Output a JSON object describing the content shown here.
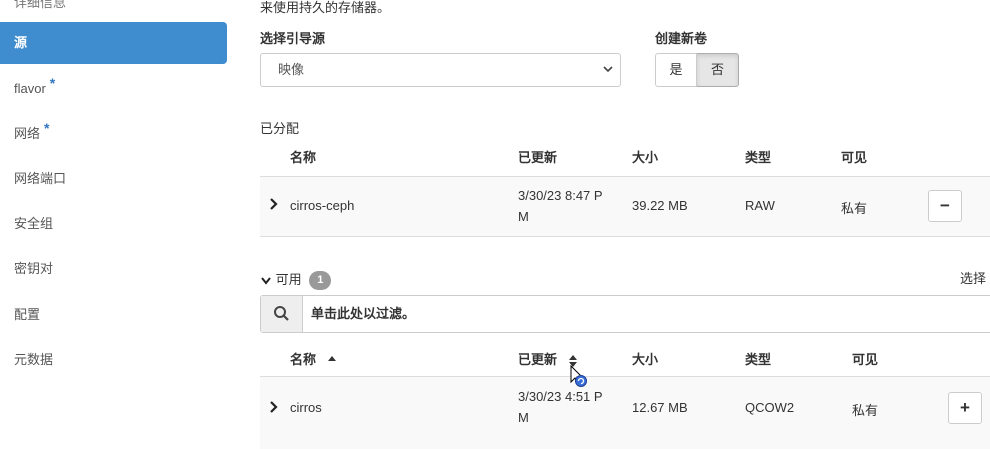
{
  "sidebar": {
    "items": [
      {
        "label": "详细信息"
      },
      {
        "label": "源"
      },
      {
        "label": "flavor",
        "required": "*"
      },
      {
        "label": "网络",
        "required": "*"
      },
      {
        "label": "网络端口"
      },
      {
        "label": "安全组"
      },
      {
        "label": "密钥对"
      },
      {
        "label": "配置"
      },
      {
        "label": "元数据"
      }
    ]
  },
  "intro_text": "来使用持久的存储器。",
  "boot_source": {
    "label": "选择引导源",
    "value": "映像"
  },
  "new_volume": {
    "label": "创建新卷",
    "yes": "是",
    "no": "否"
  },
  "allocated": {
    "title": "已分配",
    "columns": [
      "名称",
      "已更新",
      "大小",
      "类型",
      "可见"
    ],
    "rows": [
      {
        "name": "cirros-ceph",
        "updated_line1": "3/30/23 8:47 P",
        "updated_line2": "M",
        "size": "39.22 MB",
        "type": "RAW",
        "visibility": "私有",
        "action": "−"
      }
    ]
  },
  "available": {
    "title": "可用",
    "count": "1",
    "select_hint": "选择",
    "filter_placeholder": "单击此处以过滤。",
    "columns": [
      "名称",
      "已更新",
      "大小",
      "类型",
      "可见"
    ],
    "rows": [
      {
        "name": "cirros",
        "updated_line1": "3/30/23 4:51 P",
        "updated_line2": "M",
        "size": "12.67 MB",
        "type": "QCOW2",
        "visibility": "私有",
        "action": "+"
      }
    ]
  }
}
